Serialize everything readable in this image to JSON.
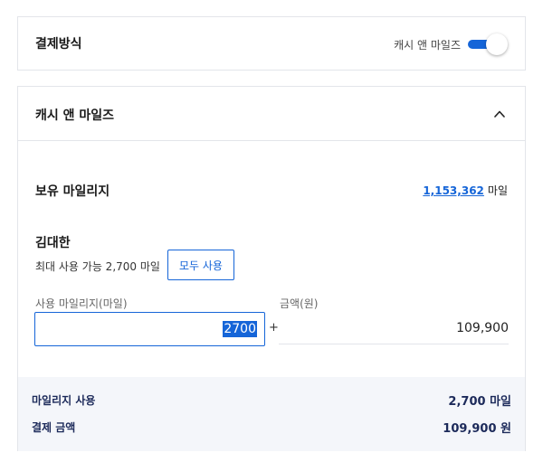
{
  "payment": {
    "title": "결제방식",
    "toggle_label": "캐시 앤 마일즈",
    "toggle_on": true
  },
  "mileage": {
    "title": "캐시 앤 마일즈",
    "owned_label": "보유 마일리지",
    "owned_value": "1,153,362",
    "owned_unit": "마일",
    "holder_name": "김대한",
    "max_use_text": "최대 사용 가능 2,700 마일",
    "use_all_label": "모두 사용",
    "use_field_label": "사용 마일리지(마일)",
    "use_field_value": "2700",
    "plus_sign": "+",
    "amount_field_label": "금액(원)",
    "amount_value": "109,900"
  },
  "summary": {
    "mileage_use_label": "마일리지 사용",
    "mileage_use_value": "2,700 마일",
    "pay_amount_label": "결제 금액",
    "pay_amount_value": "109,900 원"
  },
  "colors": {
    "accent": "#1565d8",
    "summary_bg": "#f4f6fa",
    "summary_text": "#1c2a5a"
  }
}
